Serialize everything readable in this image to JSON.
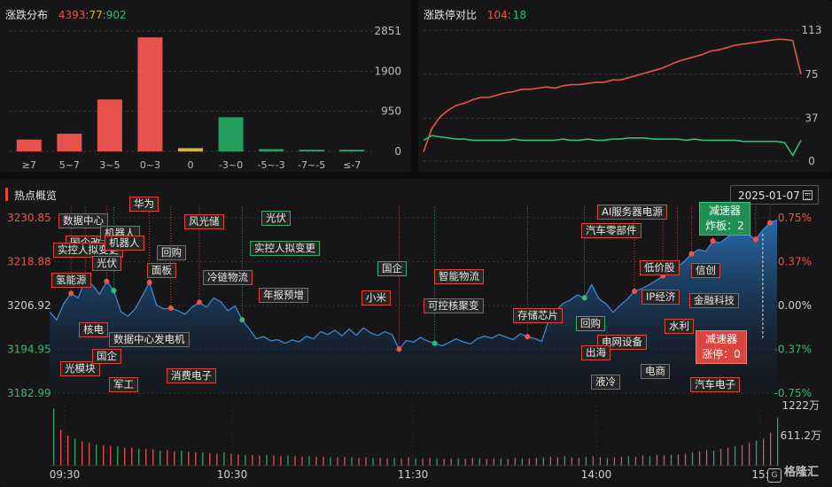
{
  "distribution": {
    "title": "涨跌分布",
    "up": "4393",
    "sep1": ":",
    "flat": "77",
    "sep2": ":",
    "down": "902",
    "y_ticks": [
      "2851",
      "1900",
      "950",
      "0"
    ],
    "chart_data": {
      "type": "bar",
      "categories": [
        "≥7",
        "5~7",
        "3~5",
        "0~3",
        "0",
        "-3~0",
        "-5~-3",
        "-7~-5",
        "≤-7"
      ],
      "values": [
        280,
        420,
        1230,
        2700,
        77,
        810,
        55,
        25,
        22
      ],
      "ylim": [
        0,
        2851
      ],
      "colors": [
        "#e8524c",
        "#e8524c",
        "#e8524c",
        "#e8524c",
        "#d9b43a",
        "#239e5e",
        "#239e5e",
        "#239e5e",
        "#239e5e"
      ]
    }
  },
  "limit_ratio": {
    "title": "涨跌停对比",
    "up_limit": "104",
    "sep": ":",
    "down_limit": "18",
    "y_ticks": [
      "113",
      "75",
      "37",
      "0"
    ],
    "chart_data": {
      "type": "line",
      "ylim": [
        0,
        113
      ],
      "series": [
        {
          "color": "#e8524c",
          "values": [
            8,
            28,
            38,
            44,
            48,
            50,
            53,
            55,
            55,
            57,
            59,
            60,
            62,
            62,
            63,
            64,
            63,
            65,
            66,
            66,
            67,
            68,
            68,
            70,
            70,
            72,
            74,
            76,
            78,
            80,
            83,
            86,
            88,
            90,
            92,
            95,
            96,
            98,
            100,
            101,
            102,
            103,
            104,
            105,
            105,
            104,
            75
          ]
        },
        {
          "color": "#2fbf6f",
          "values": [
            18,
            22,
            21,
            20,
            19,
            19,
            18,
            18,
            18,
            18,
            18,
            19,
            18,
            18,
            18,
            18,
            18,
            19,
            18,
            18,
            19,
            18,
            18,
            19,
            19,
            20,
            20,
            20,
            19,
            19,
            19,
            19,
            18,
            19,
            18,
            18,
            18,
            18,
            18,
            17,
            17,
            17,
            17,
            17,
            16,
            5,
            18
          ]
        }
      ]
    }
  },
  "hot": {
    "title": "热点概览",
    "date": "2025-01-07",
    "y_left": [
      "3230.85",
      "3218.88",
      "3206.92",
      "3194.95",
      "3182.99"
    ],
    "y_right": [
      "0.75%",
      "0.37%",
      "0.00%",
      "-0.37%",
      "-0.75%"
    ],
    "volume_ticks": [
      "1222万",
      "611.2万"
    ],
    "x_ticks": [
      "09:30",
      "10:30",
      "11:30",
      "14:00",
      "15:"
    ],
    "chart_data": {
      "type": "area",
      "ylim": [
        3182.99,
        3230.85
      ],
      "baseline": 3206.92,
      "values": [
        3205.2,
        3203.0,
        3207.5,
        3210.2,
        3209.0,
        3214.0,
        3212.5,
        3210.0,
        3213.5,
        3211.0,
        3205.2,
        3204.0,
        3206.0,
        3209.5,
        3213.2,
        3207.0,
        3206.0,
        3206.2,
        3205.5,
        3204.5,
        3206.5,
        3207.8,
        3206.4,
        3209.0,
        3207.9,
        3205.5,
        3206.8,
        3203.0,
        3200.5,
        3197.8,
        3198.4,
        3197.3,
        3197.6,
        3196.6,
        3197.5,
        3197.0,
        3198.5,
        3197.8,
        3199.8,
        3199.0,
        3200.2,
        3198.6,
        3200.5,
        3198.8,
        3200.8,
        3199.5,
        3198.7,
        3199.8,
        3199.0,
        3195.0,
        3197.4,
        3196.9,
        3198.2,
        3197.2,
        3196.6,
        3195.9,
        3196.8,
        3197.8,
        3197.0,
        3196.4,
        3197.9,
        3198.5,
        3198.0,
        3199.0,
        3198.3,
        3197.6,
        3199.2,
        3198.4,
        3197.9,
        3197.1,
        3203.0,
        3205.5,
        3207.5,
        3208.4,
        3209.8,
        3209.0,
        3212.6,
        3208.8,
        3207.4,
        3205.0,
        3207.0,
        3208.6,
        3210.8,
        3211.5,
        3212.5,
        3213.7,
        3215.0,
        3216.3,
        3217.4,
        3219.0,
        3221.0,
        3222.2,
        3221.7,
        3224.5,
        3224.0,
        3225.5,
        3226.8,
        3228.0,
        3226.2,
        3225.0,
        3227.5,
        3229.5,
        3230.3
      ]
    },
    "tags": [
      "数据中心",
      "国企改",
      "实控人拟变更",
      "机器人",
      "机器人",
      "华为",
      "风光储",
      "光伏",
      "光伏",
      "实控人拟变更",
      "氢能源",
      "面板",
      "冷链物流",
      "回购",
      "年报预增",
      "核电",
      "数据中心发电机",
      "光模块",
      "国企",
      "军工",
      "消费电子",
      "国企",
      "小米",
      "智能物流",
      "可控核聚变",
      "存储芯片",
      "回购",
      "AI服务器电源",
      "汽车零部件",
      "低价股",
      "信创",
      "IP经济",
      "金融科技",
      "电网设备",
      "水利",
      "出海",
      "液冷",
      "电商",
      "汽车电子"
    ],
    "box_top": {
      "line1": "减速器",
      "line2": "炸板：2"
    },
    "box_bottom": {
      "line1": "减速器",
      "line2": "涨停：0"
    },
    "volume": [
      95,
      60,
      50,
      45,
      40,
      38,
      35,
      34,
      33,
      32,
      30,
      30,
      28,
      28,
      27,
      25,
      26,
      24,
      25,
      23,
      22,
      22,
      21,
      20,
      22,
      20,
      19,
      18,
      18,
      17,
      18,
      17,
      16,
      17,
      16,
      15,
      16,
      15,
      15,
      14,
      14,
      15,
      14,
      13,
      14,
      13,
      13,
      12,
      13,
      12,
      14,
      12,
      12,
      13,
      12,
      11,
      12,
      12,
      11,
      13,
      12,
      11,
      12,
      12,
      11,
      13,
      12,
      12,
      13,
      14,
      15,
      14,
      16,
      14,
      13,
      15,
      16,
      14,
      13,
      14,
      15,
      16,
      15,
      17,
      16,
      18,
      17,
      18,
      19,
      20,
      22,
      24,
      26,
      25,
      28,
      30,
      32,
      34,
      38,
      42,
      45,
      55,
      80
    ]
  },
  "logo": {
    "text": "格隆汇",
    "mark": "G"
  }
}
